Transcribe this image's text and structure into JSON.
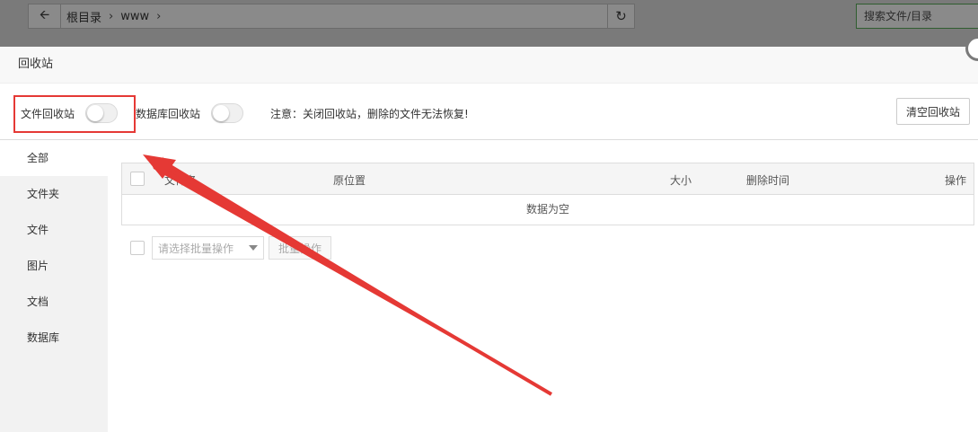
{
  "background": {
    "crumbs": [
      "根目录",
      "www"
    ],
    "search_placeholder": "搜索文件/目录"
  },
  "dialog": {
    "title": "回收站",
    "file_recycle_label": "文件回收站",
    "file_recycle_on": false,
    "db_recycle_label": "数据库回收站",
    "db_recycle_on": false,
    "note": "注意：关闭回收站，删除的文件无法恢复!",
    "clear_button": "清空回收站"
  },
  "sidebar": {
    "items": [
      {
        "label": "全部",
        "active": true
      },
      {
        "label": "文件夹"
      },
      {
        "label": "文件"
      },
      {
        "label": "图片"
      },
      {
        "label": "文档"
      },
      {
        "label": "数据库"
      }
    ]
  },
  "table": {
    "columns": [
      "文件名",
      "原位置",
      "大小",
      "删除时间",
      "操作"
    ],
    "empty_text": "数据为空"
  },
  "batch": {
    "select_placeholder": "请选择批量操作",
    "button": "批量操作"
  },
  "annotation_color": "#e53935"
}
